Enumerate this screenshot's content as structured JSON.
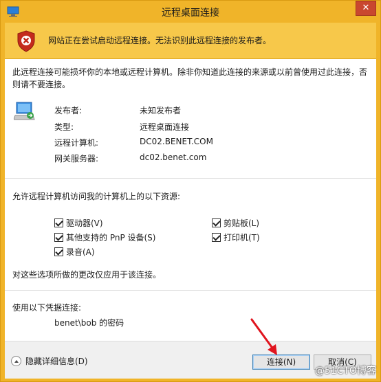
{
  "window": {
    "title": "远程桌面连接",
    "close_label": "✕"
  },
  "banner": {
    "message": "网站正在尝试启动远程连接。无法识别此远程连接的发布者。"
  },
  "warning": {
    "text": "此远程连接可能损坏你的本地或远程计算机。除非你知道此连接的来源或以前曾使用过此连接，否则请不要连接。"
  },
  "details": [
    {
      "label": "发布者:",
      "value": "未知发布者"
    },
    {
      "label": "类型:",
      "value": "远程桌面连接"
    },
    {
      "label": "远程计算机:",
      "value": "DC02.BENET.COM"
    },
    {
      "label": "网关服务器:",
      "value": "dc02.benet.com"
    }
  ],
  "resources": {
    "heading": "允许远程计算机访问我的计算机上的以下资源:",
    "items": [
      {
        "label": "驱动器(V)",
        "checked": true
      },
      {
        "label": "剪贴板(L)",
        "checked": true
      },
      {
        "label": "其他支持的 PnP 设备(S)",
        "checked": true
      },
      {
        "label": "打印机(T)",
        "checked": true
      },
      {
        "label": "录音(A)",
        "checked": true
      }
    ],
    "note": "对这些选项所做的更改仅应用于该连接。"
  },
  "credentials": {
    "heading": "使用以下凭据连接:",
    "value": "benet\\bob 的密码"
  },
  "footer": {
    "toggle_label": "隐藏详细信息(D)",
    "connect_label": "连接(N)",
    "cancel_label": "取消(C)"
  },
  "watermark": "@51CTO博客",
  "colors": {
    "accent": "#f0b429",
    "banner": "#f7c84a",
    "close": "#c9472f",
    "arrow": "#e0141e"
  }
}
